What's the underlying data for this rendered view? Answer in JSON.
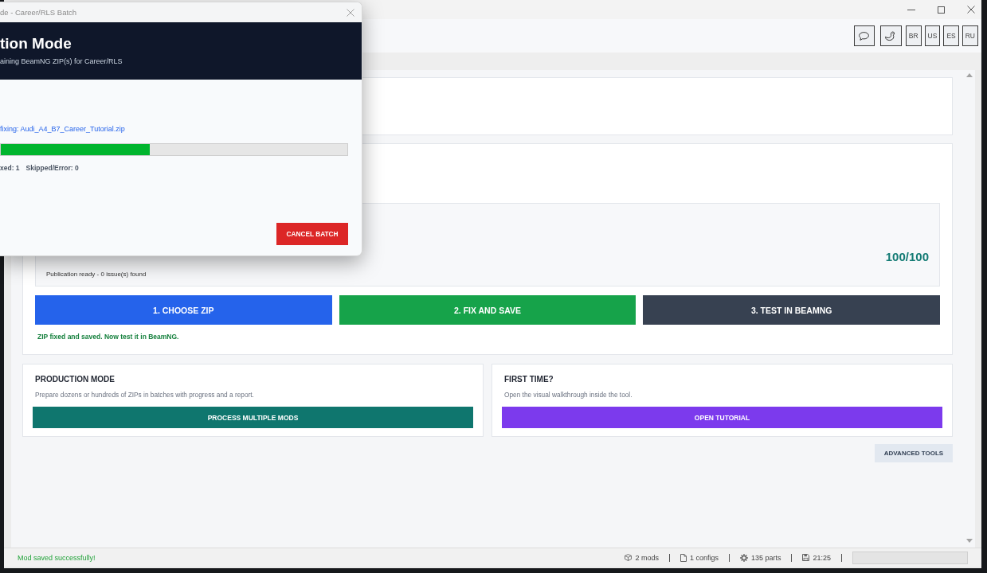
{
  "toolbar": {
    "language_buttons": [
      "BR",
      "US",
      "ES",
      "RU"
    ]
  },
  "workflow": {
    "report_status": "Publication ready - 0 issue(s) found",
    "score": "100/100",
    "steps": [
      {
        "label": "1. CHOOSE ZIP",
        "color": "#2563eb"
      },
      {
        "label": "2. FIX AND SAVE",
        "color": "#16a34a"
      },
      {
        "label": "3. TEST IN BEAMNG",
        "color": "#374151"
      }
    ],
    "message": "ZIP fixed and saved. Now test it in BeamNG."
  },
  "mode_cards": [
    {
      "title": "PRODUCTION MODE",
      "description": "Prepare dozens or hundreds of ZIPs in batches with progress and a report.",
      "button": {
        "label": "PROCESS MULTIPLE MODS",
        "color": "#0f766e"
      }
    },
    {
      "title": "FIRST TIME?",
      "description": "Open the visual walkthrough inside the tool.",
      "button": {
        "label": "OPEN TUTORIAL",
        "color": "#7c3aed"
      }
    }
  ],
  "advanced_button": "ADVANCED TOOLS",
  "status_bar": {
    "message": "Mod saved successfully!",
    "stats": [
      {
        "kind": "mods",
        "text": "2 mods"
      },
      {
        "kind": "configs",
        "text": "1 configs"
      },
      {
        "kind": "parts",
        "text": "135 parts"
      },
      {
        "kind": "time",
        "text": "21:25"
      }
    ]
  },
  "batch_dialog": {
    "title": "de - Career/RLS Batch",
    "heading": "tion Mode",
    "subtitle": "aining BeamNG ZIP(s) for Career/RLS",
    "current_file": "fixing: Audi_A4_B7_Career_Tutorial.zip",
    "progress": {
      "level": 0.43
    },
    "counts": [
      "xed: 1",
      "Skipped/Error: 0"
    ],
    "cancel_button": "CANCEL BATCH"
  }
}
